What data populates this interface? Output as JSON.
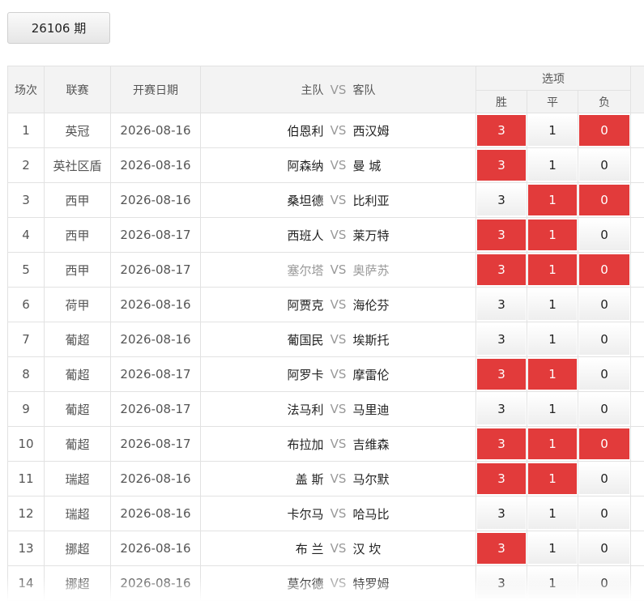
{
  "period_button": "26106 期",
  "headers": {
    "no": "场次",
    "league": "联赛",
    "date": "开赛日期",
    "home": "主队",
    "vs": "VS",
    "away": "客队",
    "options": "选项",
    "win": "胜",
    "draw": "平",
    "lose": "负"
  },
  "colors": {
    "selected": "#e23b3b",
    "header_bg": "#f3f3f3"
  },
  "rows": [
    {
      "no": "1",
      "league": "英冠",
      "date": "2026-08-16",
      "home": "伯恩利",
      "vs": "VS",
      "away": "西汉姆",
      "opt": [
        "3",
        "1",
        "0"
      ],
      "sel": [
        true,
        false,
        true
      ]
    },
    {
      "no": "2",
      "league": "英社区盾",
      "date": "2026-08-16",
      "home": "阿森纳",
      "vs": "VS",
      "away": "曼 城",
      "opt": [
        "3",
        "1",
        "0"
      ],
      "sel": [
        true,
        false,
        false
      ]
    },
    {
      "no": "3",
      "league": "西甲",
      "date": "2026-08-16",
      "home": "桑坦德",
      "vs": "VS",
      "away": "比利亚",
      "opt": [
        "3",
        "1",
        "0"
      ],
      "sel": [
        false,
        true,
        true
      ]
    },
    {
      "no": "4",
      "league": "西甲",
      "date": "2026-08-17",
      "home": "西班人",
      "vs": "VS",
      "away": "莱万特",
      "opt": [
        "3",
        "1",
        "0"
      ],
      "sel": [
        true,
        true,
        false
      ]
    },
    {
      "no": "5",
      "league": "西甲",
      "date": "2026-08-17",
      "home": "塞尔塔",
      "vs": "VS",
      "away": "奥萨苏",
      "opt": [
        "3",
        "1",
        "0"
      ],
      "sel": [
        true,
        true,
        true
      ],
      "dim": true
    },
    {
      "no": "6",
      "league": "荷甲",
      "date": "2026-08-16",
      "home": "阿贾克",
      "vs": "VS",
      "away": "海伦芬",
      "opt": [
        "3",
        "1",
        "0"
      ],
      "sel": [
        false,
        false,
        false
      ]
    },
    {
      "no": "7",
      "league": "葡超",
      "date": "2026-08-16",
      "home": "葡国民",
      "vs": "VS",
      "away": "埃斯托",
      "opt": [
        "3",
        "1",
        "0"
      ],
      "sel": [
        false,
        false,
        false
      ]
    },
    {
      "no": "8",
      "league": "葡超",
      "date": "2026-08-17",
      "home": "阿罗卡",
      "vs": "VS",
      "away": "摩雷伦",
      "opt": [
        "3",
        "1",
        "0"
      ],
      "sel": [
        true,
        true,
        false
      ]
    },
    {
      "no": "9",
      "league": "葡超",
      "date": "2026-08-17",
      "home": "法马利",
      "vs": "VS",
      "away": "马里迪",
      "opt": [
        "3",
        "1",
        "0"
      ],
      "sel": [
        false,
        false,
        false
      ]
    },
    {
      "no": "10",
      "league": "葡超",
      "date": "2026-08-17",
      "home": "布拉加",
      "vs": "VS",
      "away": "吉维森",
      "opt": [
        "3",
        "1",
        "0"
      ],
      "sel": [
        true,
        true,
        true
      ]
    },
    {
      "no": "11",
      "league": "瑞超",
      "date": "2026-08-16",
      "home": "盖 斯",
      "vs": "VS",
      "away": "马尔默",
      "opt": [
        "3",
        "1",
        "0"
      ],
      "sel": [
        true,
        true,
        false
      ]
    },
    {
      "no": "12",
      "league": "瑞超",
      "date": "2026-08-16",
      "home": "卡尔马",
      "vs": "VS",
      "away": "哈马比",
      "opt": [
        "3",
        "1",
        "0"
      ],
      "sel": [
        false,
        false,
        false
      ]
    },
    {
      "no": "13",
      "league": "挪超",
      "date": "2026-08-16",
      "home": "布 兰",
      "vs": "VS",
      "away": "汉 坎",
      "opt": [
        "3",
        "1",
        "0"
      ],
      "sel": [
        true,
        false,
        false
      ]
    },
    {
      "no": "14",
      "league": "挪超",
      "date": "2026-08-16",
      "home": "莫尔德",
      "vs": "VS",
      "away": "特罗姆",
      "opt": [
        "3",
        "1",
        "0"
      ],
      "sel": [
        false,
        false,
        false
      ]
    }
  ]
}
